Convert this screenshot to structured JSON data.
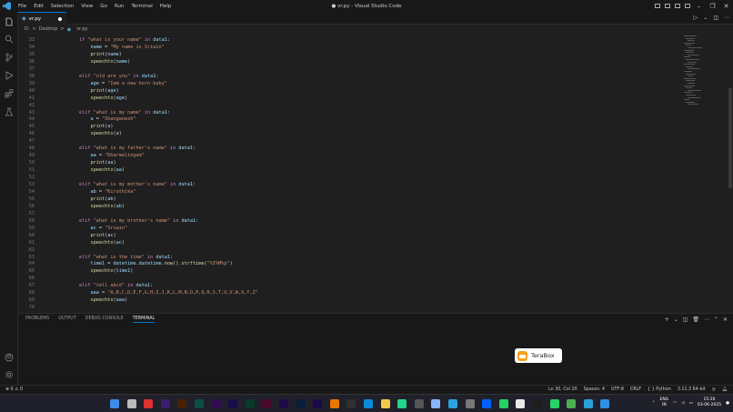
{
  "window": {
    "title": "● vr.py - Visual Studio Code",
    "menu": [
      "File",
      "Edit",
      "Selection",
      "View",
      "Go",
      "Run",
      "Terminal",
      "Help"
    ]
  },
  "tab": {
    "label": "vr.py",
    "modified": true
  },
  "breadcrumb": {
    "drive": "D:",
    "sep1": ">",
    "folder": "Desktop",
    "sep2": ">",
    "file": "vr.py"
  },
  "editor": {
    "lines": [
      {
        "n": "33",
        "tokens": [
          [
            "kw",
            "if"
          ],
          [
            "op",
            " "
          ],
          [
            "st",
            "\"what is your name\""
          ],
          [
            "op",
            " "
          ],
          [
            "kw",
            "in"
          ],
          [
            "op",
            " "
          ],
          [
            "vr",
            "data1"
          ],
          [
            "op",
            ":"
          ]
        ],
        "indent": 0
      },
      {
        "n": "34",
        "tokens": [
          [
            "vr",
            "name"
          ],
          [
            "op",
            " = "
          ],
          [
            "st",
            "\"My name is Sriwin\""
          ]
        ],
        "indent": 1
      },
      {
        "n": "35",
        "tokens": [
          [
            "fn",
            "print"
          ],
          [
            "op",
            "("
          ],
          [
            "vr",
            "name"
          ],
          [
            "op",
            ")"
          ]
        ],
        "indent": 1
      },
      {
        "n": "36",
        "tokens": [
          [
            "fn",
            "speechtx"
          ],
          [
            "op",
            "("
          ],
          [
            "vr",
            "name"
          ],
          [
            "op",
            ")"
          ]
        ],
        "indent": 1
      },
      {
        "n": "37",
        "tokens": [],
        "indent": 0
      },
      {
        "n": "38",
        "tokens": [
          [
            "kw",
            "elif"
          ],
          [
            "op",
            " "
          ],
          [
            "st",
            "\"old are you\""
          ],
          [
            "op",
            " "
          ],
          [
            "kw",
            "in"
          ],
          [
            "op",
            " "
          ],
          [
            "vr",
            "data1"
          ],
          [
            "op",
            ":"
          ]
        ],
        "indent": 0
      },
      {
        "n": "39",
        "tokens": [
          [
            "vr",
            "age"
          ],
          [
            "op",
            " = "
          ],
          [
            "st",
            "\"Iam a new born baby\""
          ]
        ],
        "indent": 1
      },
      {
        "n": "40",
        "tokens": [
          [
            "fn",
            "print"
          ],
          [
            "op",
            "("
          ],
          [
            "vr",
            "age"
          ],
          [
            "op",
            ")"
          ]
        ],
        "indent": 1
      },
      {
        "n": "41",
        "tokens": [
          [
            "fn",
            "speechtx"
          ],
          [
            "op",
            "("
          ],
          [
            "vr",
            "age"
          ],
          [
            "op",
            ")"
          ]
        ],
        "indent": 1
      },
      {
        "n": "42",
        "tokens": [],
        "indent": 0
      },
      {
        "n": "43",
        "tokens": [
          [
            "kw",
            "elif"
          ],
          [
            "op",
            " "
          ],
          [
            "st",
            "\"what is my name\""
          ],
          [
            "op",
            " "
          ],
          [
            "kw",
            "in"
          ],
          [
            "op",
            " "
          ],
          [
            "vr",
            "data1"
          ],
          [
            "op",
            ":"
          ]
        ],
        "indent": 0
      },
      {
        "n": "44",
        "tokens": [
          [
            "vr",
            "a"
          ],
          [
            "op",
            " = "
          ],
          [
            "st",
            "\"Shanganesh\""
          ]
        ],
        "indent": 1
      },
      {
        "n": "45",
        "tokens": [
          [
            "fn",
            "print"
          ],
          [
            "op",
            "("
          ],
          [
            "vr",
            "a"
          ],
          [
            "op",
            ")"
          ]
        ],
        "indent": 1
      },
      {
        "n": "46",
        "tokens": [
          [
            "fn",
            "speechtx"
          ],
          [
            "op",
            "("
          ],
          [
            "vr",
            "a"
          ],
          [
            "op",
            ")"
          ]
        ],
        "indent": 1
      },
      {
        "n": "47",
        "tokens": [],
        "indent": 0
      },
      {
        "n": "48",
        "tokens": [
          [
            "kw",
            "elif"
          ],
          [
            "op",
            " "
          ],
          [
            "st",
            "\"what is my father's name\""
          ],
          [
            "op",
            " "
          ],
          [
            "kw",
            "in"
          ],
          [
            "op",
            " "
          ],
          [
            "vr",
            "data1"
          ],
          [
            "op",
            ":"
          ]
        ],
        "indent": 0
      },
      {
        "n": "49",
        "tokens": [
          [
            "vr",
            "aa"
          ],
          [
            "op",
            " = "
          ],
          [
            "st",
            "\"Dharmalingam\""
          ]
        ],
        "indent": 1
      },
      {
        "n": "50",
        "tokens": [
          [
            "fn",
            "print"
          ],
          [
            "op",
            "("
          ],
          [
            "vr",
            "aa"
          ],
          [
            "op",
            ")"
          ]
        ],
        "indent": 1
      },
      {
        "n": "51",
        "tokens": [
          [
            "fn",
            "speechtx"
          ],
          [
            "op",
            "("
          ],
          [
            "vr",
            "aa"
          ],
          [
            "op",
            ")"
          ]
        ],
        "indent": 1
      },
      {
        "n": "52",
        "tokens": [],
        "indent": 0
      },
      {
        "n": "53",
        "tokens": [
          [
            "kw",
            "elif"
          ],
          [
            "op",
            " "
          ],
          [
            "st",
            "\"what is my mother's name\""
          ],
          [
            "op",
            " "
          ],
          [
            "kw",
            "in"
          ],
          [
            "op",
            " "
          ],
          [
            "vr",
            "data1"
          ],
          [
            "op",
            ":"
          ]
        ],
        "indent": 0
      },
      {
        "n": "54",
        "tokens": [
          [
            "vr",
            "ab"
          ],
          [
            "op",
            " = "
          ],
          [
            "st",
            "\"Kiruthika\""
          ]
        ],
        "indent": 1
      },
      {
        "n": "55",
        "tokens": [
          [
            "fn",
            "print"
          ],
          [
            "op",
            "("
          ],
          [
            "vr",
            "ab"
          ],
          [
            "op",
            ")"
          ]
        ],
        "indent": 1
      },
      {
        "n": "56",
        "tokens": [
          [
            "fn",
            "speechtx"
          ],
          [
            "op",
            "("
          ],
          [
            "vr",
            "ab"
          ],
          [
            "op",
            ")"
          ]
        ],
        "indent": 1
      },
      {
        "n": "57",
        "tokens": [],
        "indent": 0
      },
      {
        "n": "58",
        "tokens": [
          [
            "kw",
            "elif"
          ],
          [
            "op",
            " "
          ],
          [
            "st",
            "\"what is my brother's name\""
          ],
          [
            "op",
            " "
          ],
          [
            "kw",
            "in"
          ],
          [
            "op",
            " "
          ],
          [
            "vr",
            "data1"
          ],
          [
            "op",
            ":"
          ]
        ],
        "indent": 0
      },
      {
        "n": "59",
        "tokens": [
          [
            "vr",
            "ac"
          ],
          [
            "op",
            " = "
          ],
          [
            "st",
            "\"Sriwin\""
          ]
        ],
        "indent": 1
      },
      {
        "n": "60",
        "tokens": [
          [
            "fn",
            "print"
          ],
          [
            "op",
            "("
          ],
          [
            "vr",
            "ac"
          ],
          [
            "op",
            ")"
          ]
        ],
        "indent": 1
      },
      {
        "n": "61",
        "tokens": [
          [
            "fn",
            "speechtx"
          ],
          [
            "op",
            "("
          ],
          [
            "vr",
            "ac"
          ],
          [
            "op",
            ")"
          ]
        ],
        "indent": 1
      },
      {
        "n": "62",
        "tokens": [],
        "indent": 0
      },
      {
        "n": "63",
        "tokens": [
          [
            "kw",
            "elif"
          ],
          [
            "op",
            " "
          ],
          [
            "st",
            "\"what is the time\""
          ],
          [
            "op",
            " "
          ],
          [
            "kw",
            "in"
          ],
          [
            "op",
            " "
          ],
          [
            "vr",
            "data1"
          ],
          [
            "op",
            ":"
          ]
        ],
        "indent": 0
      },
      {
        "n": "64",
        "tokens": [
          [
            "vr",
            "time1"
          ],
          [
            "op",
            " = "
          ],
          [
            "vr",
            "datetime"
          ],
          [
            "op",
            "."
          ],
          [
            "vr",
            "datetime"
          ],
          [
            "op",
            "."
          ],
          [
            "fn",
            "now"
          ],
          [
            "op",
            "()."
          ],
          [
            "fn",
            "strftime"
          ],
          [
            "op",
            "("
          ],
          [
            "st",
            "\"%I%M%p\""
          ],
          [
            "op",
            ")"
          ]
        ],
        "indent": 1
      },
      {
        "n": "65",
        "tokens": [
          [
            "fn",
            "speechtx"
          ],
          [
            "op",
            "("
          ],
          [
            "vr",
            "time1"
          ],
          [
            "op",
            ")"
          ]
        ],
        "indent": 1
      },
      {
        "n": "66",
        "tokens": [],
        "indent": 0
      },
      {
        "n": "67",
        "tokens": [
          [
            "kw",
            "elif"
          ],
          [
            "op",
            " "
          ],
          [
            "st",
            "\"tell abcd\""
          ],
          [
            "op",
            " "
          ],
          [
            "kw",
            "in"
          ],
          [
            "op",
            " "
          ],
          [
            "vr",
            "data1"
          ],
          [
            "op",
            ":"
          ]
        ],
        "indent": 0
      },
      {
        "n": "68",
        "tokens": [
          [
            "vr",
            "aaa"
          ],
          [
            "op",
            " = "
          ],
          [
            "st",
            "\"A,B,C,D,E,F,G,H,I,J,K,L,M,N,O,P,Q,R,S,T,U,V,W,X,Y,Z\""
          ]
        ],
        "indent": 1
      },
      {
        "n": "69",
        "tokens": [
          [
            "fn",
            "speechtx"
          ],
          [
            "op",
            "("
          ],
          [
            "vr",
            "aaa"
          ],
          [
            "op",
            ")"
          ]
        ],
        "indent": 1
      },
      {
        "n": "70",
        "tokens": [],
        "indent": 0
      }
    ]
  },
  "panel": {
    "tabs": [
      "PROBLEMS",
      "OUTPUT",
      "DEBUG CONSOLE",
      "TERMINAL"
    ],
    "active_tab": "TERMINAL",
    "terabox_label": "TeraBox"
  },
  "status": {
    "problems": "⊗ 0 ⚠ 0",
    "position": "Ln 30, Col 20",
    "spaces": "Spaces: 4",
    "encoding": "UTF-8",
    "eol": "CRLF",
    "language": "Python",
    "interpreter": "3.11.3 64-bit"
  },
  "taskbar": {
    "lang": "ENG",
    "region": "IN",
    "time": "15:26",
    "date": "03-06-2025"
  },
  "colors": {
    "accent": "#0078d4",
    "keyword": "#c586c0",
    "string": "#ce9178",
    "function": "#dcdcaa",
    "variable": "#9cdcfe"
  }
}
